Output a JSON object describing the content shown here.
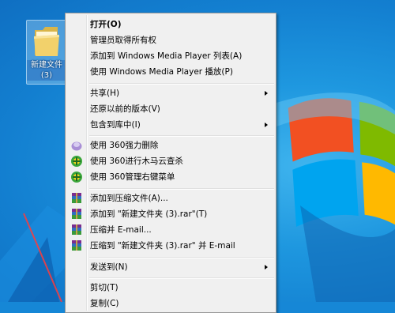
{
  "desktop": {
    "folder_label_line1": "新建文件",
    "folder_label_line2": "(3)"
  },
  "context_menu": {
    "items": [
      {
        "label": "打开(O)"
      },
      {
        "label": "管理员取得所有权"
      },
      {
        "label": "添加到 Windows Media Player 列表(A)"
      },
      {
        "label": "使用 Windows Media Player 播放(P)"
      },
      {
        "label": "共享(H)"
      },
      {
        "label": "还原以前的版本(V)"
      },
      {
        "label": "包含到库中(I)"
      },
      {
        "label": "使用 360强力删除",
        "icon": "360-shred-icon"
      },
      {
        "label": "使用 360进行木马云查杀",
        "icon": "360-scan-icon"
      },
      {
        "label": "使用 360管理右键菜单",
        "icon": "360-menu-manager-icon"
      },
      {
        "label": "添加到压缩文件(A)...",
        "icon": "winrar-icon"
      },
      {
        "label": "添加到 \"新建文件夹 (3).rar\"(T)",
        "icon": "winrar-icon"
      },
      {
        "label": "压缩并 E-mail...",
        "icon": "winrar-icon"
      },
      {
        "label": "压缩到 \"新建文件夹 (3).rar\" 并 E-mail",
        "icon": "winrar-icon"
      },
      {
        "label": "发送到(N)"
      },
      {
        "label": "剪切(T)"
      },
      {
        "label": "复制(C)"
      }
    ]
  },
  "colors": {
    "desktop_bg": "#1687d6",
    "menu_bg": "#f0f0f0",
    "menu_border": "#979797"
  }
}
